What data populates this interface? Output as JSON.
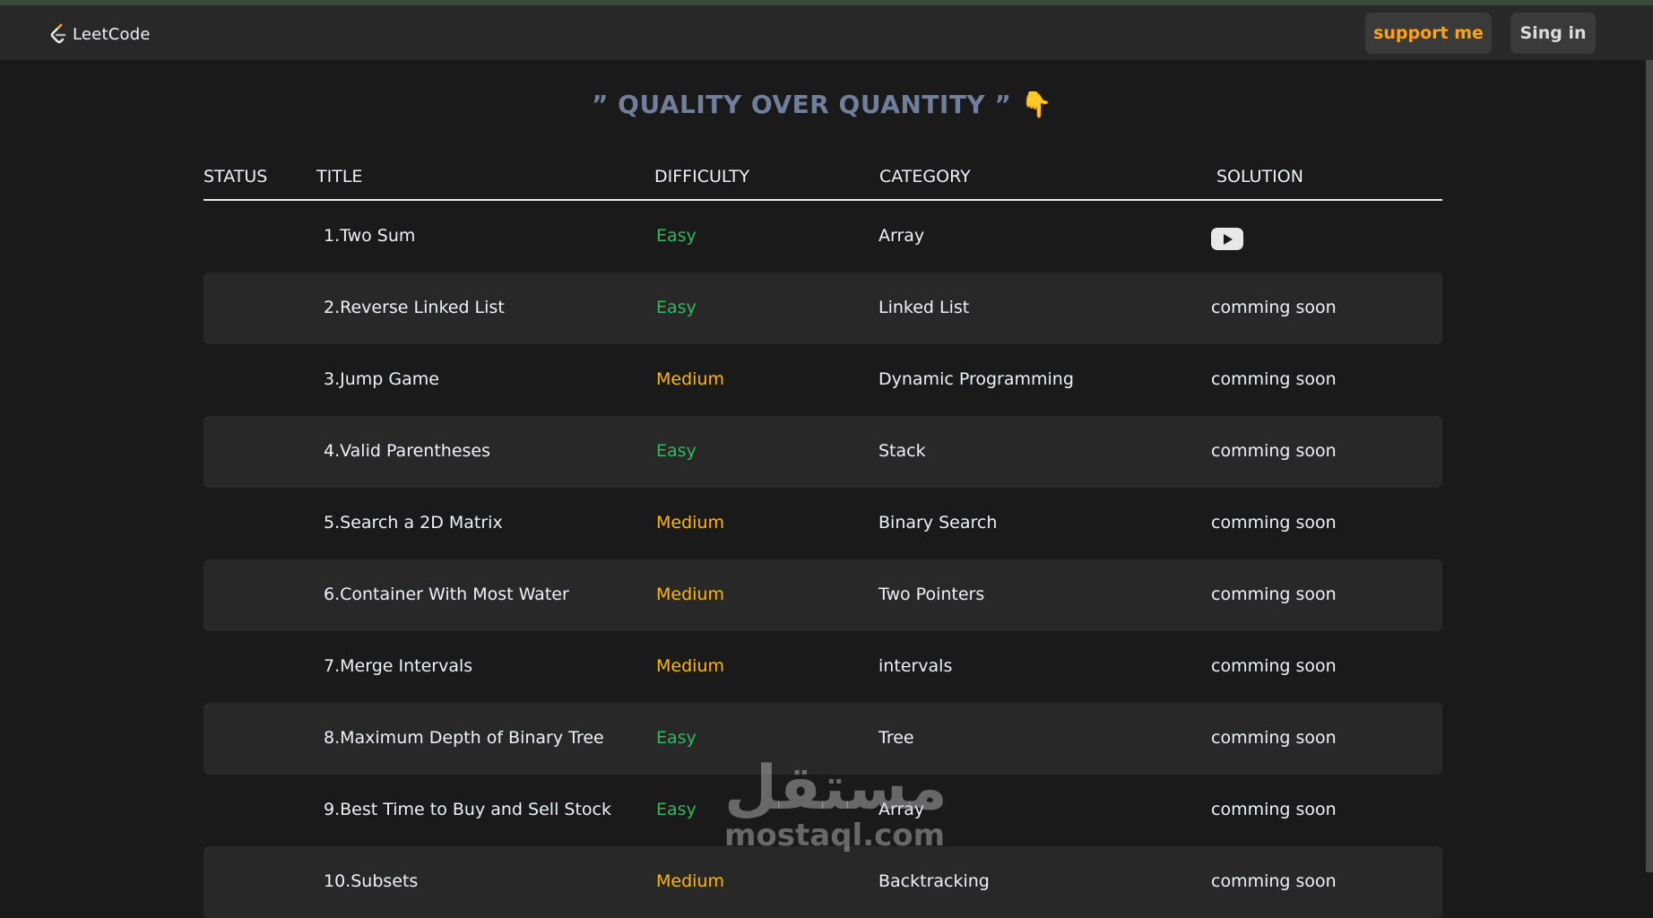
{
  "navbar": {
    "logo_text": "LeetCode",
    "support_label": "support me",
    "signin_label": "Sing in"
  },
  "quote": {
    "text": "” QUALITY OVER QUANTITY ”",
    "emoji": "👇"
  },
  "table": {
    "headers": [
      "STATUS",
      "TITLE",
      "DIFFICULTY",
      "CATEGORY",
      "SOLUTION"
    ],
    "rows": [
      {
        "title": "1.Two Sum",
        "difficulty": "Easy",
        "category": "Array",
        "solution": "youtube"
      },
      {
        "title": "2.Reverse Linked List",
        "difficulty": "Easy",
        "category": "Linked List",
        "solution": "comming soon"
      },
      {
        "title": "3.Jump Game",
        "difficulty": "Medium",
        "category": "Dynamic Programming",
        "solution": "comming soon"
      },
      {
        "title": "4.Valid Parentheses",
        "difficulty": "Easy",
        "category": "Stack",
        "solution": "comming soon"
      },
      {
        "title": "5.Search a 2D Matrix",
        "difficulty": "Medium",
        "category": "Binary Search",
        "solution": "comming soon"
      },
      {
        "title": "6.Container With Most Water",
        "difficulty": "Medium",
        "category": "Two Pointers",
        "solution": "comming soon"
      },
      {
        "title": "7.Merge Intervals",
        "difficulty": "Medium",
        "category": "intervals",
        "solution": "comming soon"
      },
      {
        "title": "8.Maximum Depth of Binary Tree",
        "difficulty": "Easy",
        "category": "Tree",
        "solution": "comming soon"
      },
      {
        "title": "9.Best Time to Buy and Sell Stock",
        "difficulty": "Easy",
        "category": "Array",
        "solution": "comming soon"
      },
      {
        "title": "10.Subsets",
        "difficulty": "Medium",
        "category": "Backtracking",
        "solution": "comming soon"
      }
    ]
  },
  "watermark": {
    "arabic": "مستقل",
    "latin": "mostaql.com"
  },
  "colors": {
    "easy": "#2cbb5d",
    "medium": "#ffb800",
    "accent": "#ffa116",
    "quote": "#6f7f9c"
  }
}
